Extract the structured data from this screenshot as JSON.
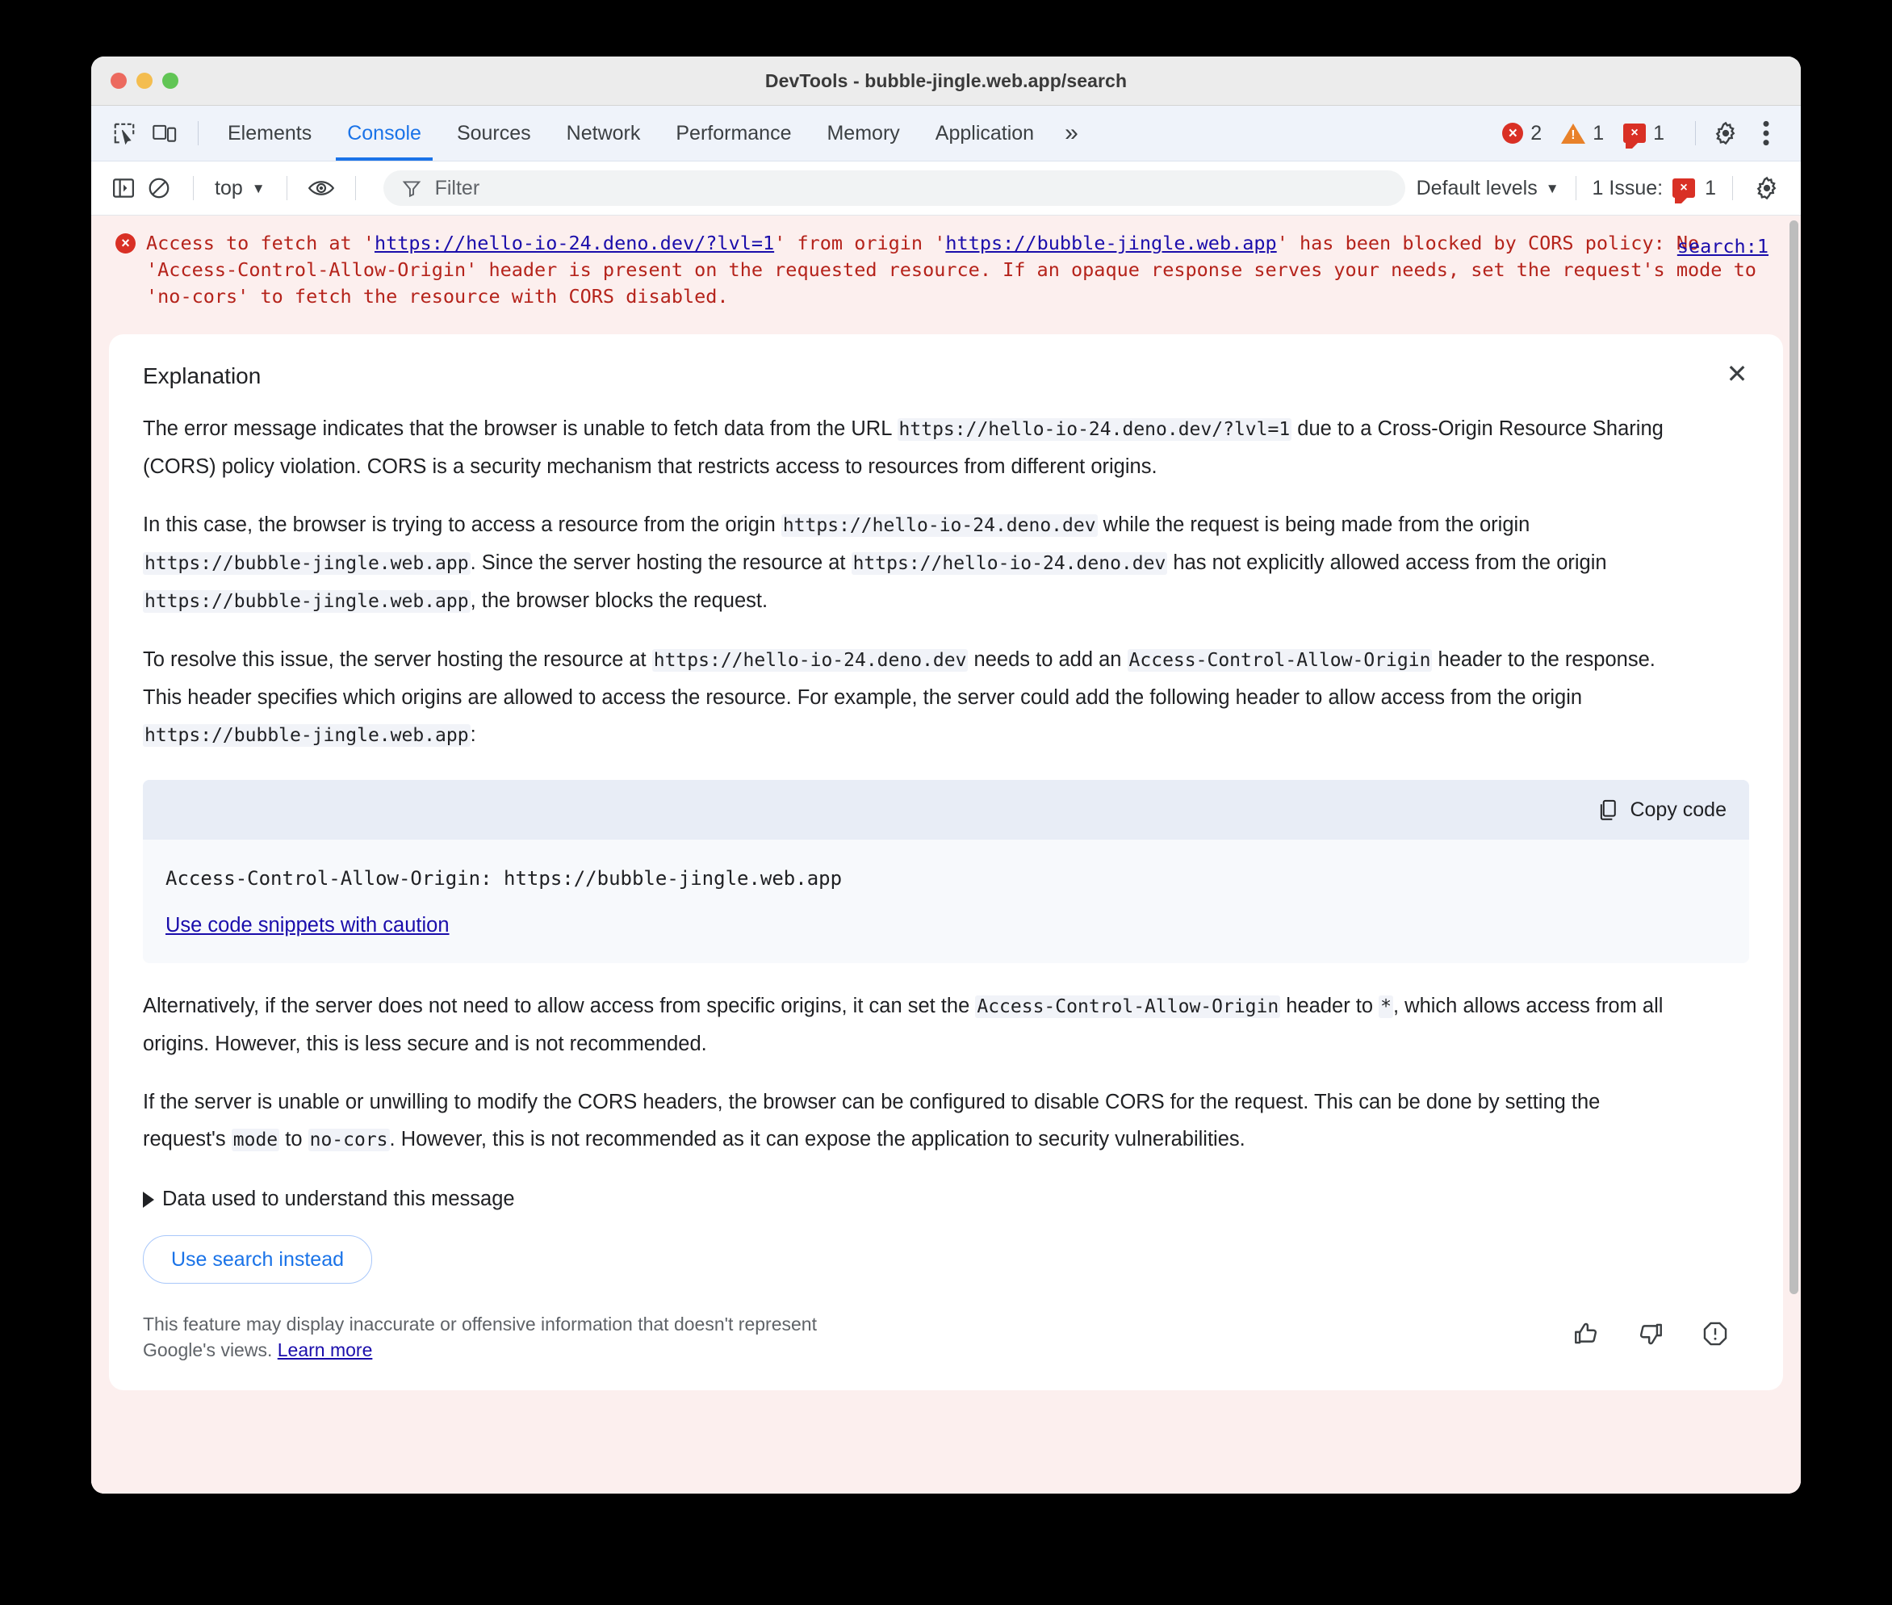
{
  "window": {
    "title": "DevTools - bubble-jingle.web.app/search",
    "traffic_lights": [
      "close",
      "minimize",
      "zoom"
    ]
  },
  "main_toolbar": {
    "inspect_icon": "inspect-element-icon",
    "device_icon": "device-toolbar-icon",
    "tabs": [
      {
        "label": "Elements",
        "active": false
      },
      {
        "label": "Console",
        "active": true
      },
      {
        "label": "Sources",
        "active": false
      },
      {
        "label": "Network",
        "active": false
      },
      {
        "label": "Performance",
        "active": false
      },
      {
        "label": "Memory",
        "active": false
      },
      {
        "label": "Application",
        "active": false
      }
    ],
    "more_tabs_label": "»",
    "errors_count": "2",
    "warnings_count": "1",
    "issues_count": "1",
    "error_glyph": "×",
    "warning_glyph": "!",
    "issue_glyph": "×",
    "settings_icon": "gear-icon",
    "more_options_icon": "kebab-menu-icon",
    "accent_blue": "#1a73e8",
    "error_red": "#d93025",
    "warning_orange": "#e8812a"
  },
  "console_toolbar": {
    "sidebar_icon": "console-sidebar-icon",
    "clear_icon": "clear-console-icon",
    "context_label": "top",
    "context_caret": "▼",
    "eye_icon": "live-expression-icon",
    "filter_icon": "filter-funnel-icon",
    "filter_value": "",
    "filter_placeholder": "Filter",
    "levels_label": "Default levels",
    "levels_caret": "▼",
    "issues_label": "1 Issue:",
    "issues_count": "1",
    "issue_glyph": "×",
    "settings_icon": "gear-icon"
  },
  "console_message": {
    "icon": "error-circle-icon",
    "icon_glyph": "×",
    "text_part1": "Access to fetch at '",
    "link1": "https://hello-io-24.deno.dev/?lvl=1",
    "text_part2": "' from origin '",
    "link2": "https://bubble-jingle.web.app",
    "text_part3": "' has been blocked by CORS policy: No 'Access-Control-Allow-Origin' header is present on the requested resource. If an opaque response serves your needs, set the request's mode to 'no-cors' to fetch the resource with CORS disabled.",
    "source_link": "search:1"
  },
  "explanation": {
    "title": "Explanation",
    "close_glyph": "✕",
    "paragraphs": [
      {
        "segments": [
          {
            "type": "text",
            "value": "The error message indicates that the browser is unable to fetch data from the URL "
          },
          {
            "type": "code",
            "value": "https://hello-io-24.deno.dev/?lvl=1"
          },
          {
            "type": "text",
            "value": " due to a Cross-Origin Resource Sharing (CORS) policy violation. CORS is a security mechanism that restricts access to resources from different origins."
          }
        ]
      },
      {
        "segments": [
          {
            "type": "text",
            "value": "In this case, the browser is trying to access a resource from the origin "
          },
          {
            "type": "code",
            "value": "https://hello-io-24.deno.dev"
          },
          {
            "type": "text",
            "value": " while the request is being made from the origin "
          },
          {
            "type": "code",
            "value": "https://bubble-jingle.web.app"
          },
          {
            "type": "text",
            "value": ". Since the server hosting the resource at "
          },
          {
            "type": "code",
            "value": "https://hello-io-24.deno.dev"
          },
          {
            "type": "text",
            "value": " has not explicitly allowed access from the origin "
          },
          {
            "type": "code",
            "value": "https://bubble-jingle.web.app"
          },
          {
            "type": "text",
            "value": ", the browser blocks the request."
          }
        ]
      },
      {
        "segments": [
          {
            "type": "text",
            "value": "To resolve this issue, the server hosting the resource at "
          },
          {
            "type": "code",
            "value": "https://hello-io-24.deno.dev"
          },
          {
            "type": "text",
            "value": " needs to add an "
          },
          {
            "type": "code",
            "value": "Access-Control-Allow-Origin"
          },
          {
            "type": "text",
            "value": " header to the response. This header specifies which origins are allowed to access the resource. For example, the server could add the following header to allow access from the origin "
          },
          {
            "type": "code",
            "value": "https://bubble-jingle.web.app"
          },
          {
            "type": "text",
            "value": ":"
          }
        ]
      }
    ],
    "code_block": {
      "copy_label": "Copy code",
      "copy_icon": "copy-icon",
      "code": "Access-Control-Allow-Origin: https://bubble-jingle.web.app",
      "caution_link": "Use code snippets with caution"
    },
    "paragraphs_after": [
      {
        "segments": [
          {
            "type": "text",
            "value": "Alternatively, if the server does not need to allow access from specific origins, it can set the "
          },
          {
            "type": "code",
            "value": "Access-Control-Allow-Origin"
          },
          {
            "type": "text",
            "value": " header to "
          },
          {
            "type": "code",
            "value": "*"
          },
          {
            "type": "text",
            "value": ", which allows access from all origins. However, this is less secure and is not recommended."
          }
        ]
      },
      {
        "segments": [
          {
            "type": "text",
            "value": "If the server is unable or unwilling to modify the CORS headers, the browser can be configured to disable CORS for the request. This can be done by setting the request's "
          },
          {
            "type": "code",
            "value": "mode"
          },
          {
            "type": "text",
            "value": " to "
          },
          {
            "type": "code",
            "value": "no-cors"
          },
          {
            "type": "text",
            "value": ". However, this is not recommended as it can expose the application to security vulnerabilities."
          }
        ]
      }
    ],
    "disclosure_label": "Data used to understand this message",
    "disclosure_glyph": "▶",
    "action_button": "Use search instead",
    "disclaimer_text": "This feature may display inaccurate or offensive information that doesn't represent Google's views. ",
    "disclaimer_link": "Learn more",
    "feedback_icons": [
      "thumb-up-icon",
      "thumb-down-icon",
      "report-icon"
    ]
  }
}
